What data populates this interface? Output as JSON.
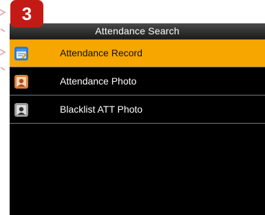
{
  "badge": {
    "number": "3",
    "color": "#c41a15"
  },
  "screen": {
    "title": "Attendance Search"
  },
  "menu": {
    "items": [
      {
        "label": "Attendance Record",
        "icon": "attendance-record-icon",
        "selected": true
      },
      {
        "label": "Attendance Photo",
        "icon": "attendance-photo-icon",
        "selected": false
      },
      {
        "label": "Blacklist ATT Photo",
        "icon": "blacklist-photo-icon",
        "selected": false
      }
    ]
  },
  "colors": {
    "selected_row": "#f7a600",
    "screen_background": "#000000",
    "title_bar": "#2a2a2a"
  }
}
